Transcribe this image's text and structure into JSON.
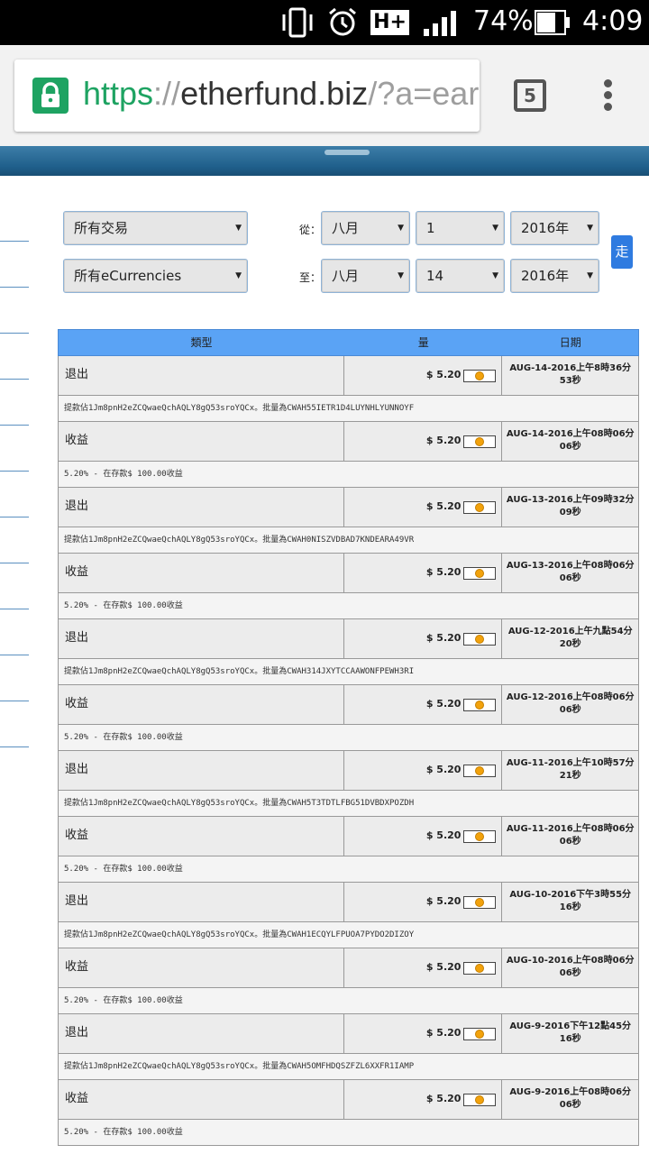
{
  "status_bar": {
    "battery": "74%",
    "time": "4:09",
    "network": "H+"
  },
  "browser": {
    "url_scheme": "https",
    "url_sep": "://",
    "url_host": "etherfund.biz",
    "url_path": "/?a=ear",
    "tab_count": "5"
  },
  "filters": {
    "type_select": "所有交易",
    "currency_select": "所有eCurrencies",
    "from_label": "從：",
    "to_label": "至：",
    "from_month": "八月",
    "from_day": "1",
    "from_year": "2016年",
    "to_month": "八月",
    "to_day": "14",
    "to_year": "2016年",
    "go_label": "走"
  },
  "table": {
    "headers": [
      "類型",
      "量",
      "日期"
    ],
    "rows": [
      {
        "type": "退出",
        "amount": "$ 5.20",
        "date": "AUG-14-2016上午8時36分53秒",
        "note": "提款佔1Jm8pnH2eZCQwaeQchAQLY8gQ53sroYQCx。批量為CWAH55IETR1D4LUYNHLYUNNOYF"
      },
      {
        "type": "收益",
        "amount": "$ 5.20",
        "date": "AUG-14-2016上午08時06分06秒",
        "note": "5.20% - 在存款$ 100.00收益"
      },
      {
        "type": "退出",
        "amount": "$ 5.20",
        "date": "AUG-13-2016上午09時32分09秒",
        "note": "提款佔1Jm8pnH2eZCQwaeQchAQLY8gQ53sroYQCx。批量為CWAH0NISZVDBAD7KNDEARA49VR"
      },
      {
        "type": "收益",
        "amount": "$ 5.20",
        "date": "AUG-13-2016上午08時06分06秒",
        "note": "5.20% - 在存款$ 100.00收益"
      },
      {
        "type": "退出",
        "amount": "$ 5.20",
        "date": "AUG-12-2016上午九點54分20秒",
        "note": "提款佔1Jm8pnH2eZCQwaeQchAQLY8gQ53sroYQCx。批量為CWAH314JXYTCCAAWONFPEWH3RI"
      },
      {
        "type": "收益",
        "amount": "$ 5.20",
        "date": "AUG-12-2016上午08時06分06秒",
        "note": "5.20% - 在存款$ 100.00收益"
      },
      {
        "type": "退出",
        "amount": "$ 5.20",
        "date": "AUG-11-2016上午10時57分21秒",
        "note": "提款佔1Jm8pnH2eZCQwaeQchAQLY8gQ53sroYQCx。批量為CWAH5T3TDTLFBG51DVBDXPOZDH"
      },
      {
        "type": "收益",
        "amount": "$ 5.20",
        "date": "AUG-11-2016上午08時06分06秒",
        "note": "5.20% - 在存款$ 100.00收益"
      },
      {
        "type": "退出",
        "amount": "$ 5.20",
        "date": "AUG-10-2016下午3時55分16秒",
        "note": "提款佔1Jm8pnH2eZCQwaeQchAQLY8gQ53sroYQCx。批量為CWAH1ECQYLFPUOA7PYDO2DIZOY"
      },
      {
        "type": "收益",
        "amount": "$ 5.20",
        "date": "AUG-10-2016上午08時06分06秒",
        "note": "5.20% - 在存款$ 100.00收益"
      },
      {
        "type": "退出",
        "amount": "$ 5.20",
        "date": "AUG-9-2016下午12點45分16秒",
        "note": "提款佔1Jm8pnH2eZCQwaeQchAQLY8gQ53sroYQCx。批量為CWAH5OMFHDQSZFZL6XXFR1IAMP"
      },
      {
        "type": "收益",
        "amount": "$ 5.20",
        "date": "AUG-9-2016上午08時06分06秒",
        "note": "5.20% - 在存款$ 100.00收益"
      }
    ]
  }
}
